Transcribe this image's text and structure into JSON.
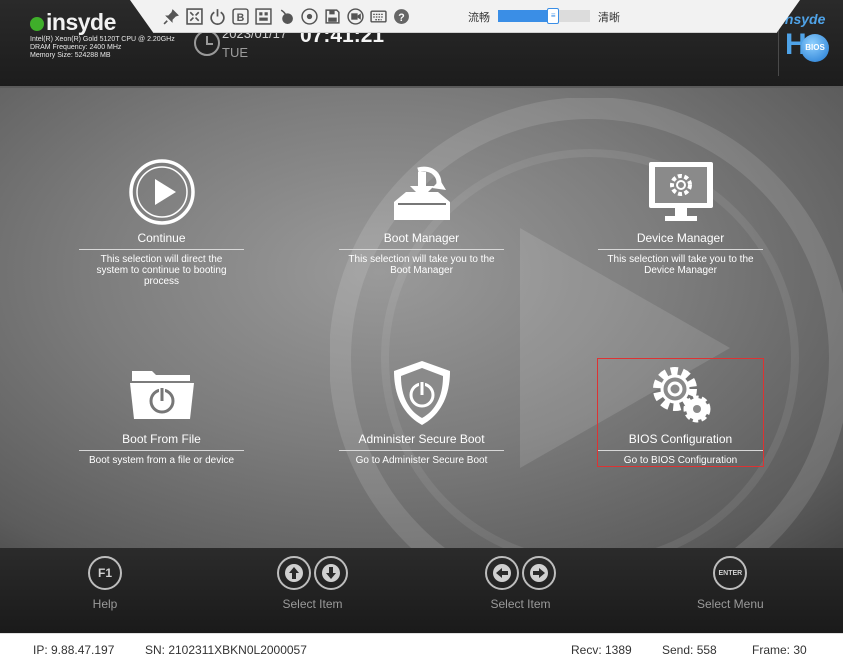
{
  "toolbar": {
    "icons": [
      "pin-icon",
      "fit-screen-icon",
      "power-icon",
      "bold-b-icon",
      "keyboard-macro-icon",
      "mouse-icon",
      "disc-icon",
      "save-icon",
      "record-icon",
      "keyboard-icon",
      "help-icon"
    ],
    "b_label": "B",
    "help_label": "?",
    "smooth_label": "流畅",
    "clear_label": "清晰",
    "quality_fraction": 0.6,
    "accent": "#3a8ee6"
  },
  "header": {
    "logo": "insyde",
    "cpu": "Intel(R) Xeon(R) Gold 5120T CPU @ 2.20GHz",
    "dram": "DRAM Frequency: 2400 MHz",
    "memory": "Memory Size: 524288 MB",
    "date": "2023/01/17",
    "weekday": "TUE",
    "time": "07:41:21",
    "brand_top": "Insyde",
    "brand_h": "H",
    "brand_badge": "BIOS"
  },
  "menu": {
    "continue": {
      "title": "Continue",
      "desc": "This selection will direct the system to continue to booting process"
    },
    "boot_manager": {
      "title": "Boot Manager",
      "desc": "This selection will take you to the Boot Manager"
    },
    "device_manager": {
      "title": "Device Manager",
      "desc": "This selection will take you to the Device Manager"
    },
    "boot_from_file": {
      "title": "Boot From File",
      "desc": "Boot system from a file or device"
    },
    "secure_boot": {
      "title": "Administer Secure Boot",
      "desc": "Go to Administer Secure Boot"
    },
    "bios_config": {
      "title": "BIOS Configuration",
      "desc": "Go to BIOS Configuration"
    },
    "selected": "BIOS Configuration",
    "selection_color": "#dd3333"
  },
  "footer": {
    "help": {
      "key": "F1",
      "label": "Help"
    },
    "select_item_vertical": {
      "label": "Select Item"
    },
    "select_item_horizontal": {
      "label": "Select Item"
    },
    "select_menu": {
      "key": "ENTER",
      "label": "Select Menu"
    }
  },
  "status": {
    "ip": "IP: 9.88.47.197",
    "sn": "SN: 2102311XBKN0L2000057",
    "recv": "Recv: 1389",
    "send": "Send: 558",
    "frame": "Frame: 30"
  }
}
